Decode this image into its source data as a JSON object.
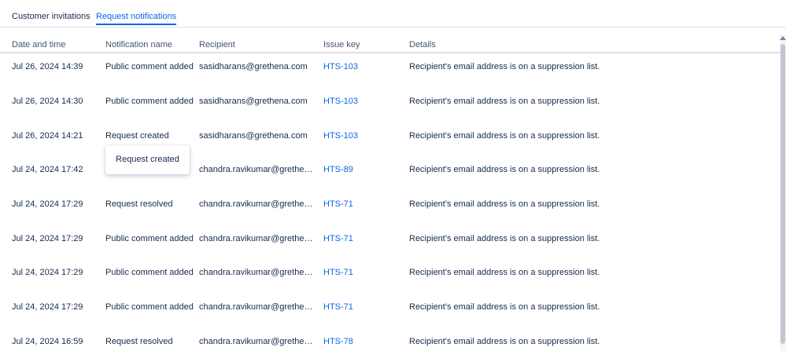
{
  "tabs": [
    {
      "label": "Customer invitations"
    },
    {
      "label": "Request notifications"
    }
  ],
  "columns": [
    "Date and time",
    "Notification name",
    "Recipient",
    "Issue key",
    "Details"
  ],
  "rows": [
    {
      "datetime": "Jul 26, 2024 14:39",
      "name": "Public comment added",
      "recipient": "sasidharans@grethena.com",
      "issue": "HTS-103",
      "details": "Recipient's email address is on a suppression list."
    },
    {
      "datetime": "Jul 26, 2024 14:30",
      "name": "Public comment added",
      "recipient": "sasidharans@grethena.com",
      "issue": "HTS-103",
      "details": "Recipient's email address is on a suppression list."
    },
    {
      "datetime": "Jul 26, 2024 14:21",
      "name": "Request created",
      "recipient": "sasidharans@grethena.com",
      "issue": "HTS-103",
      "details": "Recipient's email address is on a suppression list."
    },
    {
      "datetime": "Jul 24, 2024 17:42",
      "name": "",
      "recipient": "chandra.ravikumar@grethena....",
      "issue": "HTS-89",
      "details": "Recipient's email address is on a suppression list."
    },
    {
      "datetime": "Jul 24, 2024 17:29",
      "name": "Request resolved",
      "recipient": "chandra.ravikumar@grethena....",
      "issue": "HTS-71",
      "details": "Recipient's email address is on a suppression list."
    },
    {
      "datetime": "Jul 24, 2024 17:29",
      "name": "Public comment added",
      "recipient": "chandra.ravikumar@grethena....",
      "issue": "HTS-71",
      "details": "Recipient's email address is on a suppression list."
    },
    {
      "datetime": "Jul 24, 2024 17:29",
      "name": "Public comment added",
      "recipient": "chandra.ravikumar@grethena....",
      "issue": "HTS-71",
      "details": "Recipient's email address is on a suppression list."
    },
    {
      "datetime": "Jul 24, 2024 17:29",
      "name": "Public comment added",
      "recipient": "chandra.ravikumar@grethena....",
      "issue": "HTS-71",
      "details": "Recipient's email address is on a suppression list."
    },
    {
      "datetime": "Jul 24, 2024 16:59",
      "name": "Request resolved",
      "recipient": "chandra.ravikumar@grethena....",
      "issue": "HTS-78",
      "details": "Recipient's email address is on a suppression list."
    }
  ],
  "tooltip": {
    "text": "Request created"
  },
  "colors": {
    "accent": "#0c66e4",
    "text": "#172b4d"
  }
}
